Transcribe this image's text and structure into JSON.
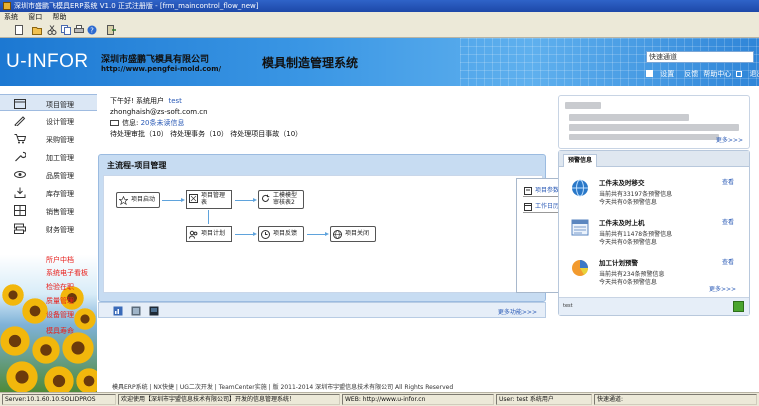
{
  "window": {
    "title": "深圳市盛鹏飞模具ERP系统 V1.0 正式注册版 - [frm_maincontrol_flow_new]"
  },
  "menu": {
    "items": [
      "系统",
      "窗口",
      "帮助"
    ]
  },
  "banner": {
    "brand": "U-INFOR",
    "company": "深圳市盛鹏飞模具有限公司",
    "url": "http://www.pengfei-mold.com/",
    "system_title": "模具制造管理系统",
    "search_placeholder": "快速通道",
    "links": [
      "设置",
      "反馈",
      "帮助中心",
      "退出"
    ]
  },
  "sidebar": {
    "items": [
      {
        "label": "项目管理",
        "icon": "calendar-icon"
      },
      {
        "label": "设计管理",
        "icon": "pencil-icon"
      },
      {
        "label": "采购管理",
        "icon": "cart-icon"
      },
      {
        "label": "加工管理",
        "icon": "wrench-icon"
      },
      {
        "label": "品质管理",
        "icon": "eye-icon"
      },
      {
        "label": "库存管理",
        "icon": "download-icon"
      },
      {
        "label": "销售管理",
        "icon": "grid-icon"
      },
      {
        "label": "财务管理",
        "icon": "stack-icon"
      }
    ],
    "red_links": [
      "所户中档",
      "系统电子看板",
      "检验在职",
      "质量管理",
      "设备管理",
      "模具寿命"
    ]
  },
  "user": {
    "greeting": "下午好! 系统用户",
    "name": "test",
    "email": "zhonghaish@zs-soft.com.cn",
    "msg_label": "信息:",
    "msg_value": "20条未读信息",
    "pending": "待处理审批（10）  待处理事务（10）  待处理项目事故（10）"
  },
  "flow": {
    "title": "主流程-项目管理",
    "nodes": {
      "launch": "项目启动",
      "plan_mgmt": "项目管理表",
      "review": "工模模型审核表2",
      "plan": "项目计划",
      "feedback": "项目反馈",
      "close": "项目关闭"
    },
    "side_items": [
      "项目参数设置",
      "工作日历"
    ],
    "more": "更多功能>>>"
  },
  "info_more": "更多>>>",
  "alerts": {
    "tab": "预警信息",
    "items": [
      {
        "title": "工件未及时移交",
        "line1": "当前共有33197条预警信息",
        "line2": "今天共有0条预警信息",
        "view": "查看"
      },
      {
        "title": "工件未及时上机",
        "line1": "当前共有11478条预警信息",
        "line2": "今天共有0条预警信息",
        "view": "查看"
      },
      {
        "title": "加工计划预警",
        "line1": "当前共有234条预警信息",
        "line2": "今天共有0条预警信息",
        "view": "查看"
      }
    ],
    "more": "更多>>>",
    "foot": "test"
  },
  "footer": "模具ERP系统 | NX快捷 | UG二次开发 | TeamCenter实施 | 版 2011-2014 深圳市宇盟信息技术有限公司 All Rights Reserved",
  "statusbar": {
    "server": "Server:10.1.60.10.SOLIDPROS",
    "welcome": "欢迎使用【深圳市宇盟信息技术有限公司】开发的信息管理系统！",
    "web": "WEB: http://www.u-infor.cn",
    "user": "User: test  系统用户",
    "status": "快速通道:"
  }
}
